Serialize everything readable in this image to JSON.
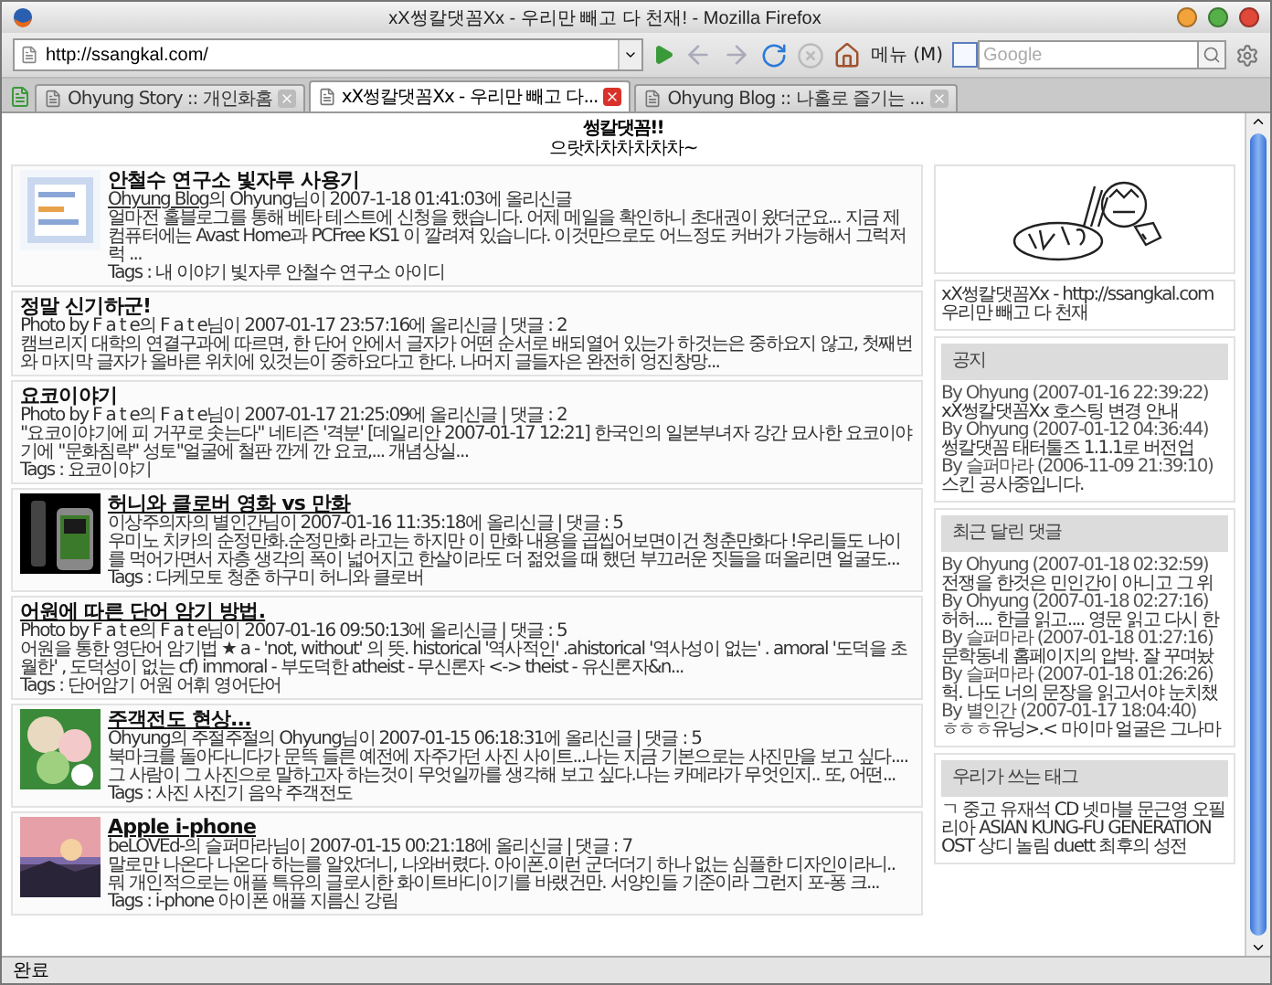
{
  "window": {
    "title": "xX썽칼댓꼼Xx - 우리만 빼고 다 천재! - Mozilla Firefox"
  },
  "toolbar": {
    "url": "http://ssangkal.com/",
    "menu_label": "메뉴 (M)",
    "search": {
      "placeholder": "Google"
    }
  },
  "tabs": [
    {
      "label": "Ohyung Story :: 개인화홈",
      "selected": false
    },
    {
      "label": "xX썽칼댓꼼Xx - 우리만 빼고 다...",
      "selected": true
    },
    {
      "label": "Ohyung Blog :: 나홀로 즐기는 ...",
      "selected": false
    }
  ],
  "page": {
    "heading": "썽칼댓꼼!!",
    "subheading": "으랏차차차차차차~"
  },
  "posts": [
    {
      "title": "안철수 연구소 빛자루 사용기",
      "underlined": false,
      "source": "Ohyung Blog",
      "meta": "의 Ohyung님이 2007-1-18 01:41:03에 올리신글",
      "excerpt": "얼마전 홀블로그를 통해 베타 테스트에 신청을 했습니다. 어제 메일을 확인하니 초대권이 왔더군요... 지금 제 컴퓨터에는 Avast Home과 PCFree KS1 이 깔려져 있습니다. 이것만으로도 어느정도 커버가 가능해서 그럭저럭 ...",
      "tags": "Tags : 내 이야기 빛자루 안철수 연구소 아이디"
    },
    {
      "title": "정말 신기하군!",
      "underlined": false,
      "meta": "Photo by F a t e의 F a t e님이 2007-01-17 23:57:16에 올리신글 | 댓글 : 2",
      "excerpt": "캠브리지 대학의 연결구과에 따르면, 한 단어 안에서 글자가 어떤 순서로 배되열어 있는가 하것는은 중하요지 않고, 첫째번와 마지막 글자가 올바른 위치에 있것는이 중하요다고 한다. 나머지 글들자은 완전히 엉진창망..."
    },
    {
      "title": "요코이야기",
      "underlined": false,
      "meta": "Photo by F a t e의 F a t e님이 2007-01-17 21:25:09에 올리신글 | 댓글 : 2",
      "excerpt": "\"요코이야기에 피 거꾸로 솟는다\" 네티즌 '격분' [데일리안 2007-01-17 12:21] 한국인의 일본부녀자 강간 묘사한 요코이야기에 \"문화침략\" 성토\"얼굴에 철판 깐게 깐 요코,... 개념상실...",
      "tags": "Tags : 요코이야기"
    },
    {
      "title": "허니와 클로버 영화 vs 만화",
      "underlined": true,
      "meta": "이상주의자의 별인간님이 2007-01-16 11:35:18에 올리신글 | 댓글 : 5",
      "excerpt": "우미노 치카의 순정만화.순정만화 라고는 하지만 이 만화 내용을 곱씹어보면이건 청춘만화다 !우리들도 나이를 먹어가면서 자층 생각의 폭이 넓어지고 한살이라도 더 젊었을 때 했던 부끄러운 짓들을 떠올리면 얼굴도...",
      "tags": "Tags : 다케모토 청춘 하구미 허니와 클로버"
    },
    {
      "title": "어원에 따른 단어 암기 방법.",
      "underlined": true,
      "meta": "Photo by F a t e의 F a t e님이 2007-01-16 09:50:13에 올리신글 | 댓글 : 5",
      "excerpt": "어원을 통한 영단어 암기법 ★ a - 'not, without' 의 뜻. historical '역사적인' .ahistorical '역사성이 없는' . amoral '도덕을 초월한' , 도덕성이 없는 cf) immoral - 부도덕한 atheist - 무신론자 <-> theist - 유신론자&n...",
      "tags": "Tags : 단어암기 어원 어휘 영어단어"
    },
    {
      "title": "주객전도 현상...",
      "underlined": true,
      "meta": "Ohyung의 주절주절의 Ohyung님이 2007-01-15 06:18:31에 올리신글 | 댓글 : 5",
      "excerpt": "북마크를 돌아다니다가 문뜩 들른 예전에 자주가던 사진 사이트...나는 지금 기본으로는 사진만을 보고 싶다....그 사람이 그 사진으로 말하고자 하는것이 무엇일까를 생각해 보고 싶다.나는 카메라가 무엇인지.. 또, 어떤...",
      "tags": "Tags : 사진 사진기 음악 주객전도"
    },
    {
      "title": "Apple i-phone",
      "underlined": true,
      "meta": "beLOVEd-의 슬퍼마라님이 2007-01-15 00:21:18에 올리신글 | 댓글 : 7",
      "excerpt": "말로만 나온다 나온다 하는를 알았더니, 나와버렸다. 아이폰.이런 군더더기 하나 없는 심플한 디자인이라니.. 뭐 개인적으로는 애플 특유의 글로시한 화이트바디이기를 바랬건만. 서양인들 기준이라 그런지 포-퐁 크...",
      "tags": "Tags : i-phone 아이폰 애플 지름신 강림"
    }
  ],
  "sidebar": {
    "site": {
      "name_line": "xX썽칼댓꼼Xx - http://ssangkal.com",
      "tagline": "우리만 빼고 다 천재"
    },
    "notices": {
      "title": "공지",
      "items": [
        {
          "byline": "By Ohyung (2007-01-16 22:39:22)",
          "text": "xX썽칼댓꼼Xx 호스팅 변경 안내"
        },
        {
          "byline": "By Ohyung (2007-01-12 04:36:44)",
          "text": "썽칼댓꼼 태터툴즈 1.1.1로 버전업"
        },
        {
          "byline": "By 슬퍼마라 (2006-11-09 21:39:10)",
          "text": "스킨 공사중입니다."
        }
      ]
    },
    "comments": {
      "title": "최근 달린 댓글",
      "items": [
        {
          "byline": "By Ohyung (2007-01-18 02:32:59)",
          "text": "전쟁을 한것은 민인간이 아니고 그 위"
        },
        {
          "byline": "By Ohyung (2007-01-18 02:27:16)",
          "text": "허허.... 한글 읽고.... 영문 읽고 다시 한"
        },
        {
          "byline": "By 슬퍼마라 (2007-01-18 01:27:16)",
          "text": "문학동네 홈페이지의 압박. 잘 꾸며놨"
        },
        {
          "byline": "By 슬퍼마라 (2007-01-18 01:26:26)",
          "text": "헉. 나도 너의 문장을 읽고서야 눈치챘"
        },
        {
          "byline": "By 별인간 (2007-01-17 18:04:40)",
          "text": "ㅎㅎㅎ유닝>.< 마이마 얼굴은 그나마"
        }
      ]
    },
    "tag_cloud": {
      "title": "우리가 쓰는 태그",
      "text": "ㄱ 중고 유재석 CD 넷마블 문근영 오필리아 ASIAN KUNG-FU GENERATION OST 상디 놀림 duett 최후의 성전"
    }
  },
  "status_bar": {
    "text": "완료"
  }
}
